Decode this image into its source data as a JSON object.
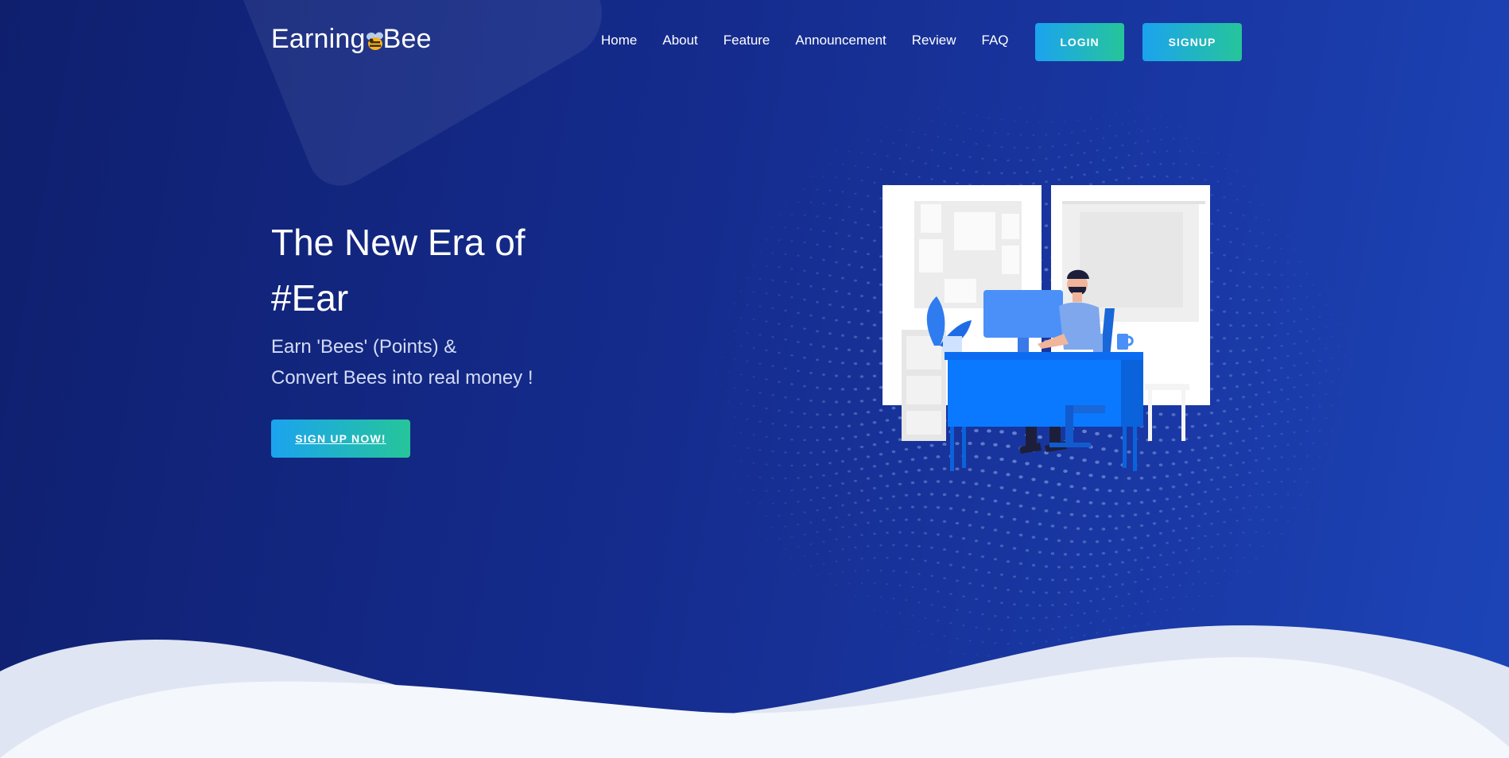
{
  "brand": {
    "name_part1": "Earning",
    "name_part2": "Bee",
    "logo_icon": "bee-icon"
  },
  "nav": {
    "items": [
      {
        "label": "Home"
      },
      {
        "label": "About"
      },
      {
        "label": "Feature"
      },
      {
        "label": "Announcement"
      },
      {
        "label": "Review"
      },
      {
        "label": "FAQ"
      }
    ],
    "login_label": "LOGIN",
    "signup_label": "SIGNUP"
  },
  "hero": {
    "title_line1": "The New Era of",
    "title_line2": "#Ear",
    "subtitle_line1": "Earn 'Bees' (Points) &",
    "subtitle_line2": "Convert Bees into real money !",
    "cta_label": "SIGN UP NOW!",
    "illustration": "man-working-at-desk-illustration"
  },
  "colors": {
    "background_dark": "#0f1f6e",
    "background_light": "#1d45b8",
    "button_gradient_start": "#1ba3ef",
    "button_gradient_end": "#26c59a",
    "wave_back": "#dfe5f3",
    "wave_front": "#f4f7fb"
  }
}
